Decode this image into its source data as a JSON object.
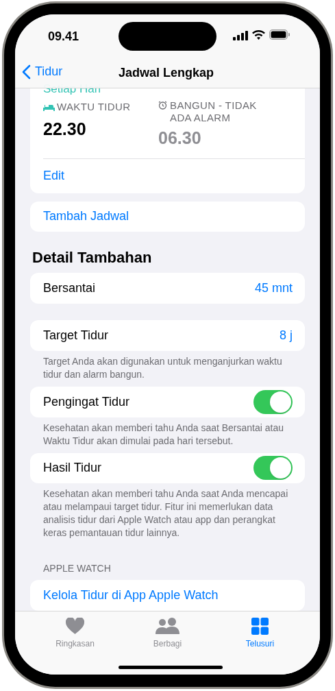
{
  "status_bar": {
    "time": "09.41"
  },
  "nav": {
    "back": "Tidur",
    "title": "Jadwal Lengkap"
  },
  "schedule": {
    "repeat": "Setiap Hari",
    "bedtime_label": "WAKTU TIDUR",
    "bedtime": "22.30",
    "wake_label": "BANGUN - TIDAK ADA ALARM",
    "wake": "06.30",
    "edit": "Edit"
  },
  "add_schedule": "Tambah Jadwal",
  "section_title": "Detail Tambahan",
  "rows": [
    {
      "kind": "value",
      "label": "Bersantai",
      "value": "45 mnt"
    },
    {
      "kind": "value",
      "label": "Target Tidur",
      "value": "8 j",
      "footnote": "Target Anda akan digunakan untuk menganjurkan waktu tidur dan alarm bangun."
    },
    {
      "kind": "toggle",
      "label": "Pengingat Tidur",
      "on": true,
      "footnote": "Kesehatan akan memberi tahu Anda saat Bersantai atau Waktu Tidur akan dimulai pada hari tersebut."
    },
    {
      "kind": "toggle",
      "label": "Hasil Tidur",
      "on": true,
      "footnote": "Kesehatan akan memberi tahu Anda saat Anda mencapai atau melampaui target tidur. Fitur ini memerlukan data analisis tidur dari Apple Watch atau app dan perangkat keras pemantauan tidur lainnya."
    }
  ],
  "apple_watch": {
    "header": "APPLE WATCH",
    "link": "Kelola Tidur di App Apple Watch"
  },
  "tabs": [
    {
      "kind": "heart",
      "label": "Ringkasan",
      "selected": false
    },
    {
      "kind": "people",
      "label": "Berbagi",
      "selected": false
    },
    {
      "kind": "grid",
      "label": "Telusuri",
      "selected": true
    }
  ]
}
